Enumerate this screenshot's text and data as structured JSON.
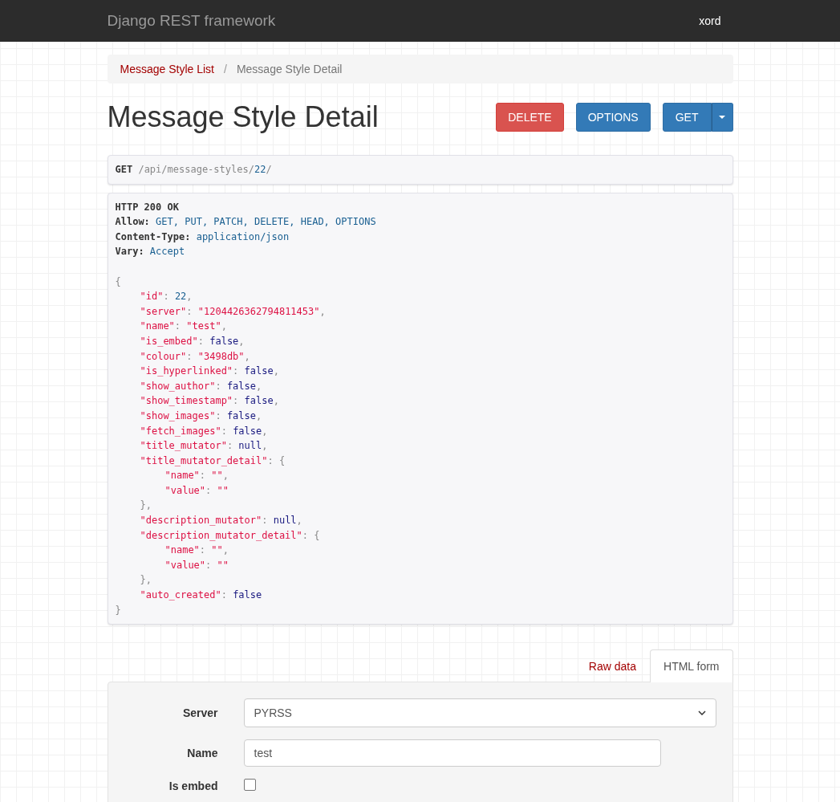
{
  "navbar": {
    "brand": "Django REST framework",
    "user": "xord"
  },
  "breadcrumb_separator": "/",
  "breadcrumb": [
    {
      "label": "Message Style List",
      "active": false
    },
    {
      "label": "Message Style Detail",
      "active": true
    }
  ],
  "title": "Message Style Detail",
  "buttons": [
    {
      "label": "DELETE",
      "kind": "danger"
    },
    {
      "label": "OPTIONS",
      "kind": "primary"
    },
    {
      "label": "GET",
      "kind": "split"
    }
  ],
  "request": {
    "method": "GET",
    "path": [
      {
        "text": "/api/message-styles/",
        "kind": "punct"
      },
      {
        "text": "22",
        "kind": "number"
      },
      {
        "text": "/",
        "kind": "punct"
      }
    ]
  },
  "response": {
    "status": "HTTP 200 OK",
    "headers": [
      {
        "name": "Allow:",
        "value": "GET, PUT, PATCH, DELETE, HEAD, OPTIONS"
      },
      {
        "name": "Content-Type:",
        "value": "application/json"
      },
      {
        "name": "Vary:",
        "value": "Accept"
      }
    ],
    "open": "{",
    "close": "}",
    "entries": [
      {
        "key": "\"id\"",
        "colon": ":",
        "value": "22",
        "kind": "number",
        "end": ","
      },
      {
        "key": "\"server\"",
        "colon": ":",
        "value": "\"1204426362794811453\"",
        "kind": "string",
        "end": ","
      },
      {
        "key": "\"name\"",
        "colon": ":",
        "value": "\"test\"",
        "kind": "string",
        "end": ","
      },
      {
        "key": "\"is_embed\"",
        "colon": ":",
        "value": "false",
        "kind": "literal",
        "end": ","
      },
      {
        "key": "\"colour\"",
        "colon": ":",
        "value": "\"3498db\"",
        "kind": "string",
        "end": ","
      },
      {
        "key": "\"is_hyperlinked\"",
        "colon": ":",
        "value": "false",
        "kind": "literal",
        "end": ","
      },
      {
        "key": "\"show_author\"",
        "colon": ":",
        "value": "false",
        "kind": "literal",
        "end": ","
      },
      {
        "key": "\"show_timestamp\"",
        "colon": ":",
        "value": "false",
        "kind": "literal",
        "end": ","
      },
      {
        "key": "\"show_images\"",
        "colon": ":",
        "value": "false",
        "kind": "literal",
        "end": ","
      },
      {
        "key": "\"fetch_images\"",
        "colon": ":",
        "value": "false",
        "kind": "literal",
        "end": ","
      },
      {
        "key": "\"title_mutator\"",
        "colon": ":",
        "value": "null",
        "kind": "literal",
        "end": ","
      },
      {
        "key": "\"title_mutator_detail\"",
        "colon": ":",
        "value": "{",
        "kind": "object",
        "end": "},",
        "children": [
          {
            "key": "\"name\"",
            "colon": ":",
            "value": "\"\"",
            "kind": "string",
            "end": ","
          },
          {
            "key": "\"value\"",
            "colon": ":",
            "value": "\"\"",
            "kind": "string"
          }
        ]
      },
      {
        "key": "\"description_mutator\"",
        "colon": ":",
        "value": "null",
        "kind": "literal",
        "end": ","
      },
      {
        "key": "\"description_mutator_detail\"",
        "colon": ":",
        "value": "{",
        "kind": "object",
        "end": "},",
        "children": [
          {
            "key": "\"name\"",
            "colon": ":",
            "value": "\"\"",
            "kind": "string",
            "end": ","
          },
          {
            "key": "\"value\"",
            "colon": ":",
            "value": "\"\"",
            "kind": "string"
          }
        ]
      },
      {
        "key": "\"auto_created\"",
        "colon": ":",
        "value": "false",
        "kind": "literal"
      }
    ]
  },
  "form_tabs": [
    {
      "label": "Raw data",
      "selected": false
    },
    {
      "label": "HTML form",
      "selected": true
    }
  ],
  "form_fields": [
    {
      "label": "Server",
      "kind": "select",
      "value": "PYRSS"
    },
    {
      "label": "Name",
      "kind": "text",
      "value": "test"
    },
    {
      "label": "Is embed",
      "kind": "checkbox",
      "checked": false
    }
  ]
}
